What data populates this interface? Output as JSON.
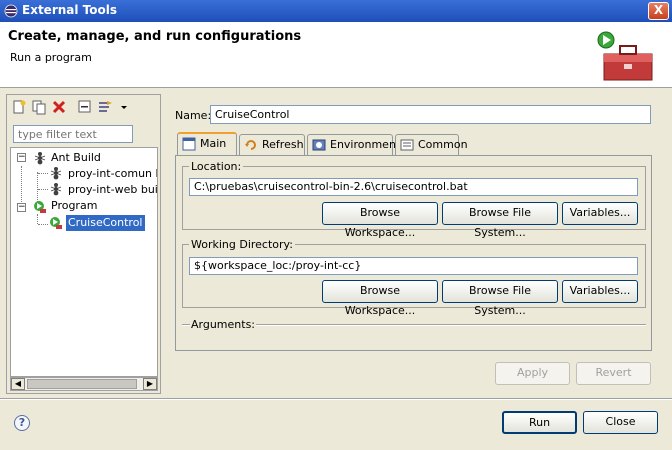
{
  "window": {
    "title": "External Tools",
    "close_label": "X"
  },
  "header": {
    "title": "Create, manage, and run configurations",
    "subtitle": "Run a program"
  },
  "left": {
    "filter_placeholder": "type filter text",
    "tree": {
      "ant_build": "Ant Build",
      "ant_children": [
        "proy-int-comun b",
        "proy-int-web buil"
      ],
      "program": "Program",
      "program_children": [
        "CruiseControl"
      ]
    },
    "scroll_left": "◀",
    "scroll_right": "▶"
  },
  "name": {
    "label": "Name:",
    "value": "CruiseControl"
  },
  "tabs": [
    "Main",
    "Refresh",
    "Environment",
    "Common"
  ],
  "location": {
    "label": "Location:",
    "value": "C:\\pruebas\\cruisecontrol-bin-2.6\\cruisecontrol.bat",
    "buttons": [
      "Browse Workspace...",
      "Browse File System...",
      "Variables..."
    ]
  },
  "working_dir": {
    "label": "Working Directory:",
    "value": "${workspace_loc:/proy-int-cc}",
    "buttons": [
      "Browse Workspace...",
      "Browse File System...",
      "Variables..."
    ]
  },
  "arguments": {
    "label": "Arguments:"
  },
  "actions": {
    "apply": "Apply",
    "revert": "Revert",
    "run": "Run",
    "close": "Close"
  },
  "help_label": "?",
  "colors": {
    "selection": "#316ac5",
    "titlebar": "#1e4fb8",
    "window_bg": "#ece9d8"
  }
}
